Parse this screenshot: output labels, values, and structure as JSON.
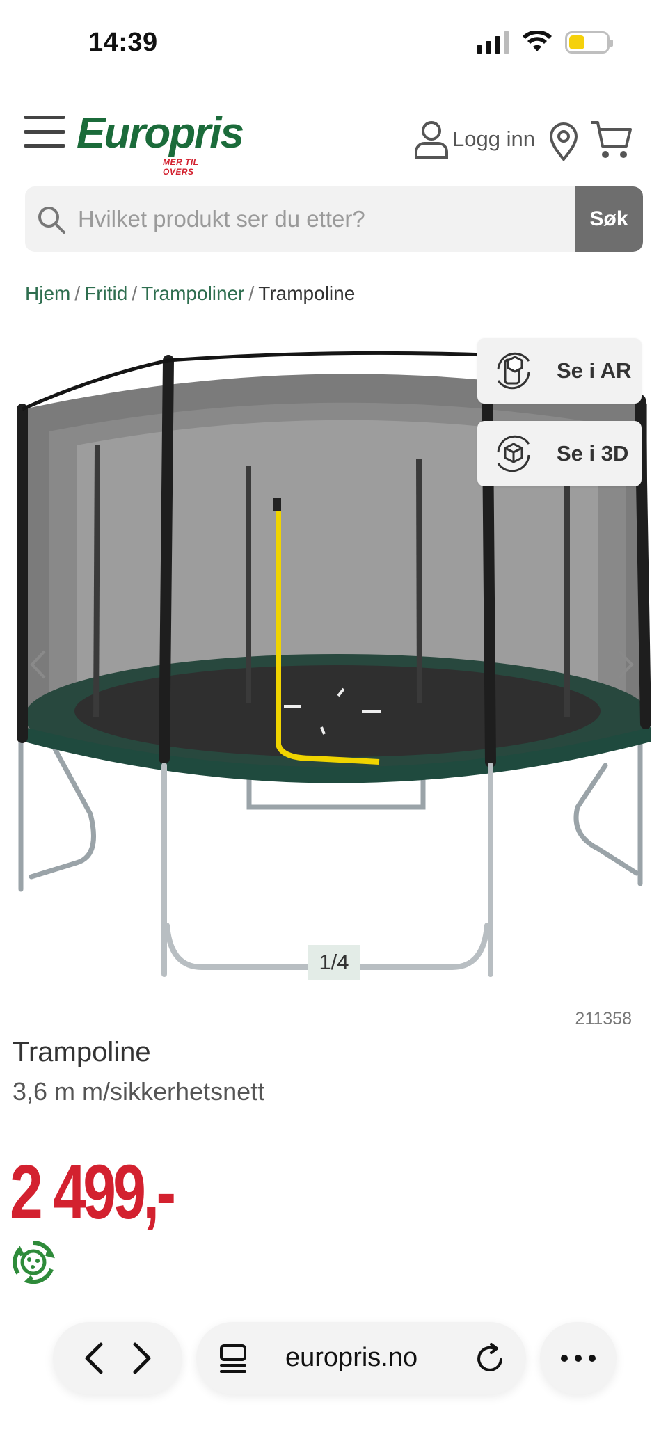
{
  "status_bar": {
    "time": "14:39",
    "battery_level": 0.25,
    "signal_bars": 3
  },
  "header": {
    "logo": {
      "name": "Europris",
      "tagline": "MER TIL OVERS"
    },
    "login_label": "Logg inn",
    "icons": [
      "menu-icon",
      "user-icon",
      "location-pin-icon",
      "cart-icon"
    ]
  },
  "search": {
    "placeholder": "Hvilket produkt ser du etter?",
    "button_label": "Søk"
  },
  "breadcrumb": {
    "links": [
      "Hjem",
      "Fritid",
      "Trampoliner"
    ],
    "current": "Trampoline",
    "separator": "/"
  },
  "gallery": {
    "ar_label": "Se i AR",
    "threed_label": "Se i 3D",
    "pager": "1/4"
  },
  "product": {
    "sku": "211358",
    "title": "Trampoline",
    "subtitle": "3,6 m m/sikkerhetsnett",
    "price": "2 499,-"
  },
  "browser": {
    "url": "europris.no"
  },
  "colors": {
    "brand_green": "#1b6b3a",
    "price_red": "#d3212f",
    "breadcrumb_green": "#2e6e4f",
    "search_button": "#6e6e6e"
  }
}
